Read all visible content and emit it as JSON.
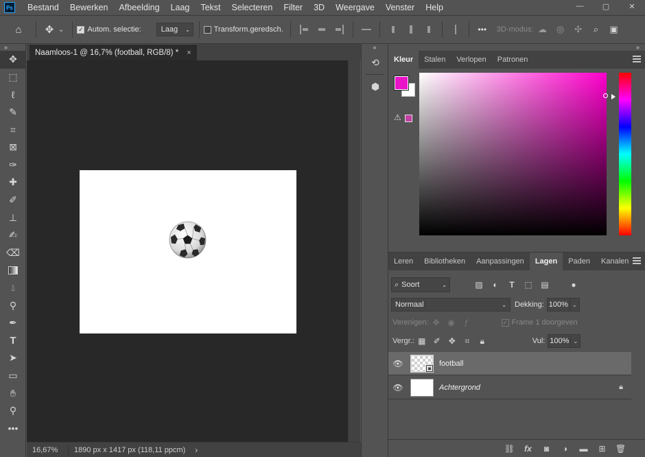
{
  "app": {
    "logo": "Ps"
  },
  "menu": [
    "Bestand",
    "Bewerken",
    "Afbeelding",
    "Laag",
    "Tekst",
    "Selecteren",
    "Filter",
    "3D",
    "Weergave",
    "Venster",
    "Help"
  ],
  "window_controls": {
    "minimize": "—",
    "maximize": "▢",
    "close": "✕"
  },
  "options": {
    "home_icon": "⌂",
    "move_icon": "✥",
    "caret": "⌄",
    "auto_select_label": "Autom. selectie:",
    "auto_select_checked": true,
    "layer_dropdown": "Laag",
    "transform_label": "Transform.geredsch.",
    "more": "•••",
    "mode_3d": "3D-modus:"
  },
  "document": {
    "tab_title": "Naamloos-1 @ 16,7% (football, RGB/8) *",
    "tab_close": "×",
    "zoom": "16,67%",
    "doc_size": "1890 px x 1417 px (118,11 ppcm)",
    "status_arrow": "›"
  },
  "color_panel": {
    "tabs": [
      "Kleur",
      "Stalen",
      "Verlopen",
      "Patronen"
    ],
    "active_tab": "Kleur",
    "foreground": "#e913c8",
    "background": "#ffffff",
    "warning_icon": "⚠"
  },
  "layers_panel": {
    "tabs": [
      "Leren",
      "Bibliotheken",
      "Aanpassingen",
      "Lagen",
      "Paden",
      "Kanalen"
    ],
    "active_tab": "Lagen",
    "filter_label": "Soort",
    "blend_mode": "Normaal",
    "opacity_label": "Dekking:",
    "opacity_value": "100%",
    "unify_label": "Verenigen:",
    "propagate_label": "Frame 1 doorgeven",
    "lock_label": "Vergr.:",
    "fill_label": "Vul:",
    "fill_value": "100%",
    "layers": [
      {
        "name": "football",
        "selected": true,
        "visible": true,
        "locked": false
      },
      {
        "name": "Achtergrond",
        "selected": false,
        "visible": true,
        "locked": true
      }
    ],
    "footer_icons": [
      "link-icon",
      "fx-icon",
      "mask-icon",
      "adjustment-icon",
      "folder-icon",
      "new-layer-icon",
      "trash-icon"
    ]
  },
  "toolbar": {
    "tools": [
      "move-tool",
      "marquee-tool",
      "lasso-tool",
      "quick-select-tool",
      "crop-tool",
      "frame-tool",
      "eyedropper-tool",
      "healing-tool",
      "brush-tool",
      "stamp-tool",
      "history-brush-tool",
      "eraser-tool",
      "gradient-tool",
      "blur-tool",
      "dodge-tool",
      "pen-tool",
      "type-tool",
      "path-select-tool",
      "rectangle-tool",
      "hand-tool",
      "zoom-tool",
      "more-tools"
    ]
  }
}
